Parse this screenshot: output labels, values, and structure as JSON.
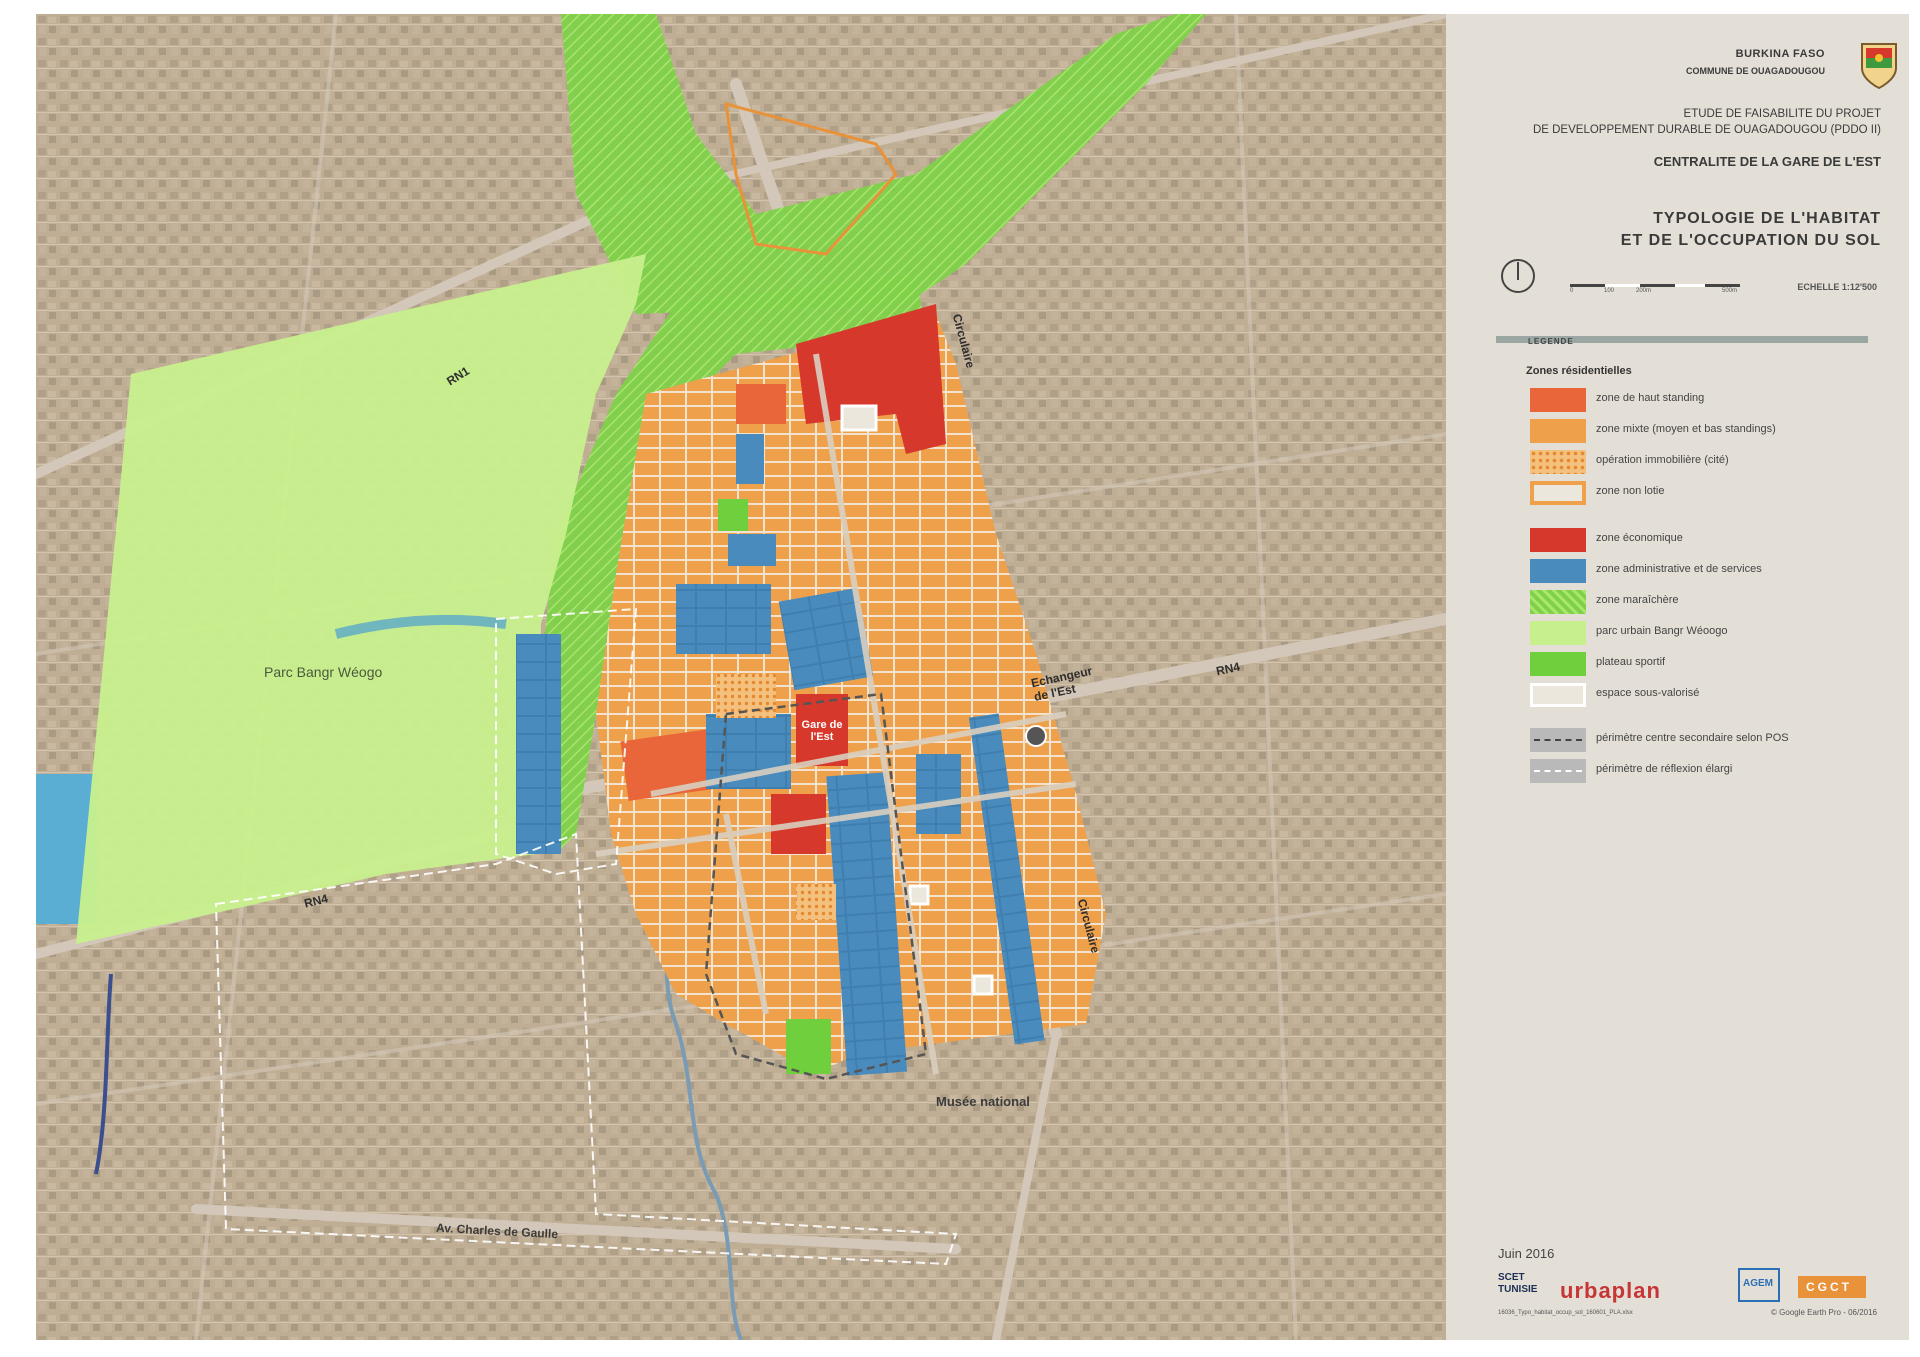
{
  "colors": {
    "haut_standing": "#e8663a",
    "mixte": "#eea14a",
    "economique": "#d7382c",
    "administrative": "#4a8bbd",
    "maraichere": "#7fd14a",
    "parc": "#c8ef8e",
    "plateau": "#6fcf3c",
    "sous_valorise": "#ece7dc",
    "satellite": "#b9a78e",
    "panel": "#e3dfd6"
  },
  "header": {
    "country": "BURKINA FASO",
    "commune": "COMMUNE DE OUAGADOUGOU",
    "study_line1": "ETUDE DE FAISABILITE DU PROJET",
    "study_line2": "DE DEVELOPPEMENT DURABLE DE OUAGADOUGOU (PDDO II)",
    "centralite": "CENTRALITE DE LA GARE DE L'EST",
    "title_line1": "TYPOLOGIE DE L'HABITAT",
    "title_line2": "ET DE L'OCCUPATION DU SOL",
    "scale_label": "ECHELLE 1:12'500",
    "scale_ticks": [
      "0",
      "100",
      "200m",
      "500m"
    ],
    "seal_icon": "coat-of-arms-icon",
    "north_icon": "north-arrow-icon"
  },
  "legend": {
    "title": "LEGENDE",
    "residential_title": "Zones résidentielles",
    "items": [
      {
        "label": "zone de haut standing",
        "icon": "solid-swatch"
      },
      {
        "label": "zone mixte (moyen et bas standings)",
        "icon": "solid-swatch"
      },
      {
        "label": "opération immobilière (cité)",
        "icon": "dotted-swatch"
      },
      {
        "label": "zone non lotie",
        "icon": "outline-swatch"
      },
      {
        "label": "zone économique",
        "icon": "solid-swatch"
      },
      {
        "label": "zone administrative et de services",
        "icon": "solid-swatch"
      },
      {
        "label": "zone maraîchère",
        "icon": "hatched-swatch"
      },
      {
        "label": "parc urbain Bangr Wéoogo",
        "icon": "solid-swatch"
      },
      {
        "label": "plateau sportif",
        "icon": "solid-swatch"
      },
      {
        "label": "espace sous-valorisé",
        "icon": "outline-swatch"
      },
      {
        "label": "périmètre centre secondaire selon POS",
        "icon": "dashed-line"
      },
      {
        "label": "périmètre de réflexion élargi",
        "icon": "dashed-line-white"
      }
    ]
  },
  "footer": {
    "date": "Juin 2016",
    "logo_scet": "SCET TUNISIE",
    "logo_urbaplan": "urbaplan",
    "logo_agem": "AGEM",
    "logo_cgct": "CGCT",
    "file_ref": "16036_Typo_habitat_occup_sol_160601_PLA.xlsx",
    "credit": "© Google Earth Pro - 06/2016"
  },
  "map_labels": {
    "parc": "Parc Bangr Wéogo",
    "gare": "Gare de l'Est",
    "musee": "Musée national",
    "av": "Av. Charles de Gaulle",
    "rn4_east": "RN4",
    "rn4_west": "RN4",
    "rn1": "RN1",
    "circulaire_n": "Circulaire",
    "circulaire_s": "Circulaire",
    "echangeur": "Echangeur de l'Est"
  }
}
